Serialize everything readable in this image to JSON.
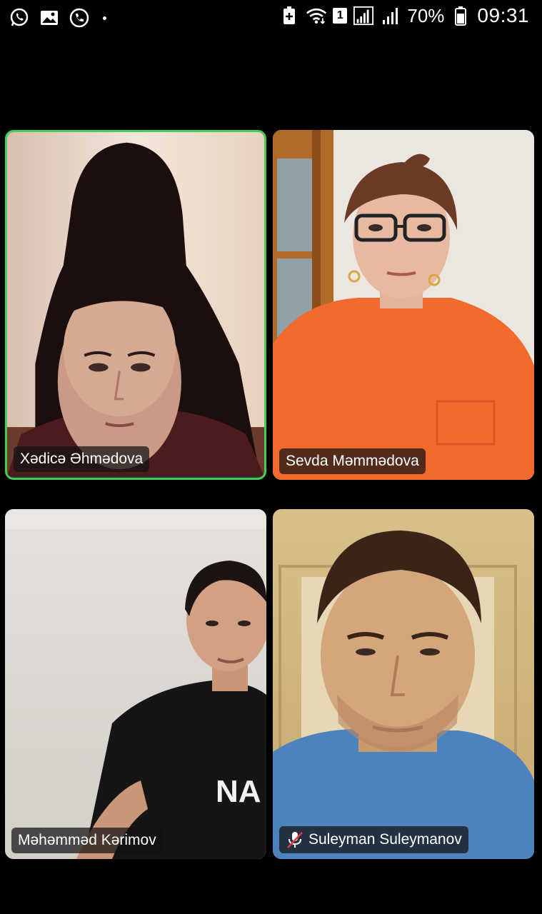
{
  "status_bar": {
    "left_icons": [
      "whatsapp-icon",
      "gallery-icon",
      "call-icon",
      "dot-icon"
    ],
    "sim_badge": "1",
    "battery_percent": "70%",
    "time": "09:31"
  },
  "participants": [
    {
      "name": "Xədicə Əhmədova",
      "active_speaker": true,
      "muted": false
    },
    {
      "name": "Sevda Məmmədova",
      "active_speaker": false,
      "muted": false
    },
    {
      "name": "Məhəmməd Kərimov",
      "active_speaker": false,
      "muted": false
    },
    {
      "name": "Suleyman Suleymanov",
      "active_speaker": false,
      "muted": true
    }
  ],
  "colors": {
    "active_border": "#3fce5a",
    "background": "#000000",
    "muted_icon": "#e53935"
  }
}
